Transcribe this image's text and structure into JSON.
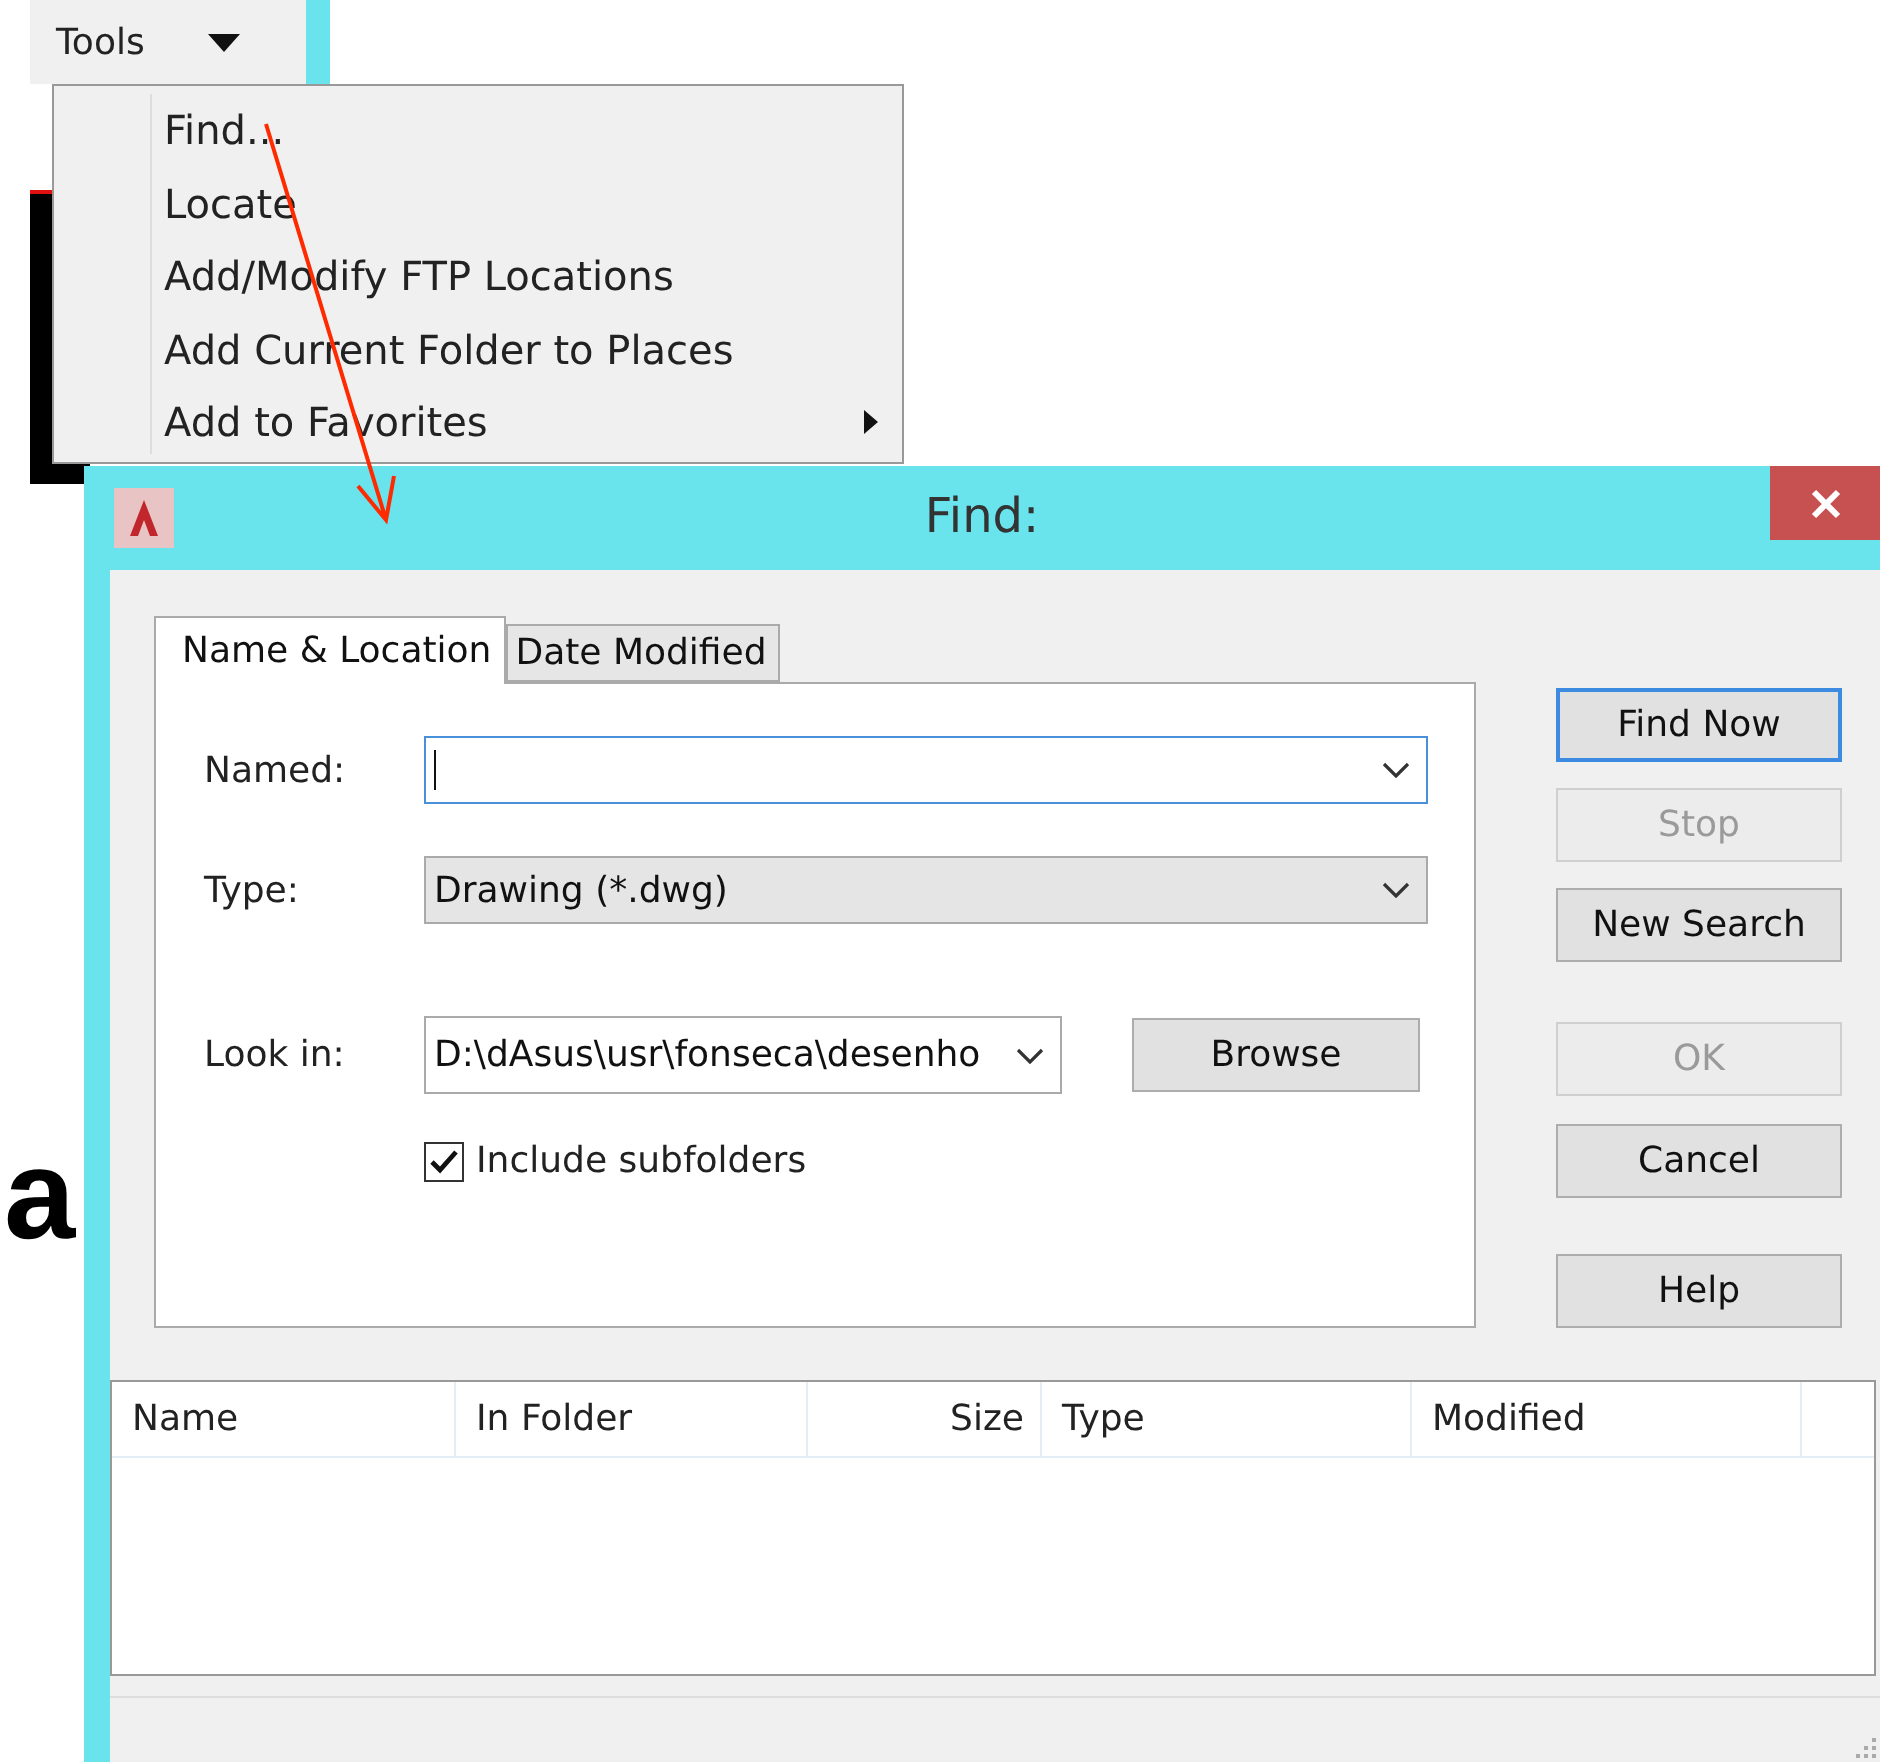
{
  "menubar": {
    "label": "Tools"
  },
  "menu": {
    "items": [
      {
        "label": "Find...",
        "submenu": false
      },
      {
        "label": "Locate",
        "submenu": false
      },
      {
        "label": "Add/Modify FTP Locations",
        "submenu": false
      },
      {
        "label": "Add Current Folder to Places",
        "submenu": false
      },
      {
        "label": "Add to Favorites",
        "submenu": true
      }
    ]
  },
  "background_text": "a",
  "dialog": {
    "title": "Find:",
    "tabs": [
      {
        "label": "Name & Location",
        "selected": true
      },
      {
        "label": "Date Modified",
        "selected": false
      }
    ],
    "named": {
      "label": "Named:"
    },
    "type": {
      "label": "Type:",
      "value": "Drawing (*.dwg)"
    },
    "look_in": {
      "label": "Look in:",
      "value": "D:\\dAsus\\usr\\fonseca\\desenho",
      "button": "Browse"
    },
    "include_subfolders": {
      "label": "Include subfolders",
      "checked": true
    },
    "buttons": [
      {
        "label": "Find Now",
        "disabled": false,
        "focused": true
      },
      {
        "label": "Stop",
        "disabled": true,
        "focused": false
      },
      {
        "label": "New Search",
        "disabled": false,
        "focused": false
      },
      {
        "label": "OK",
        "disabled": true,
        "focused": false
      },
      {
        "label": "Cancel",
        "disabled": false,
        "focused": false
      },
      {
        "label": "Help",
        "disabled": false,
        "focused": false
      }
    ],
    "results": {
      "columns": [
        {
          "label": "Name",
          "kind": "text"
        },
        {
          "label": "In Folder",
          "kind": "text"
        },
        {
          "label": "Size",
          "kind": "number"
        },
        {
          "label": "Type",
          "kind": "text"
        },
        {
          "label": "Modified",
          "kind": "text"
        }
      ]
    }
  }
}
